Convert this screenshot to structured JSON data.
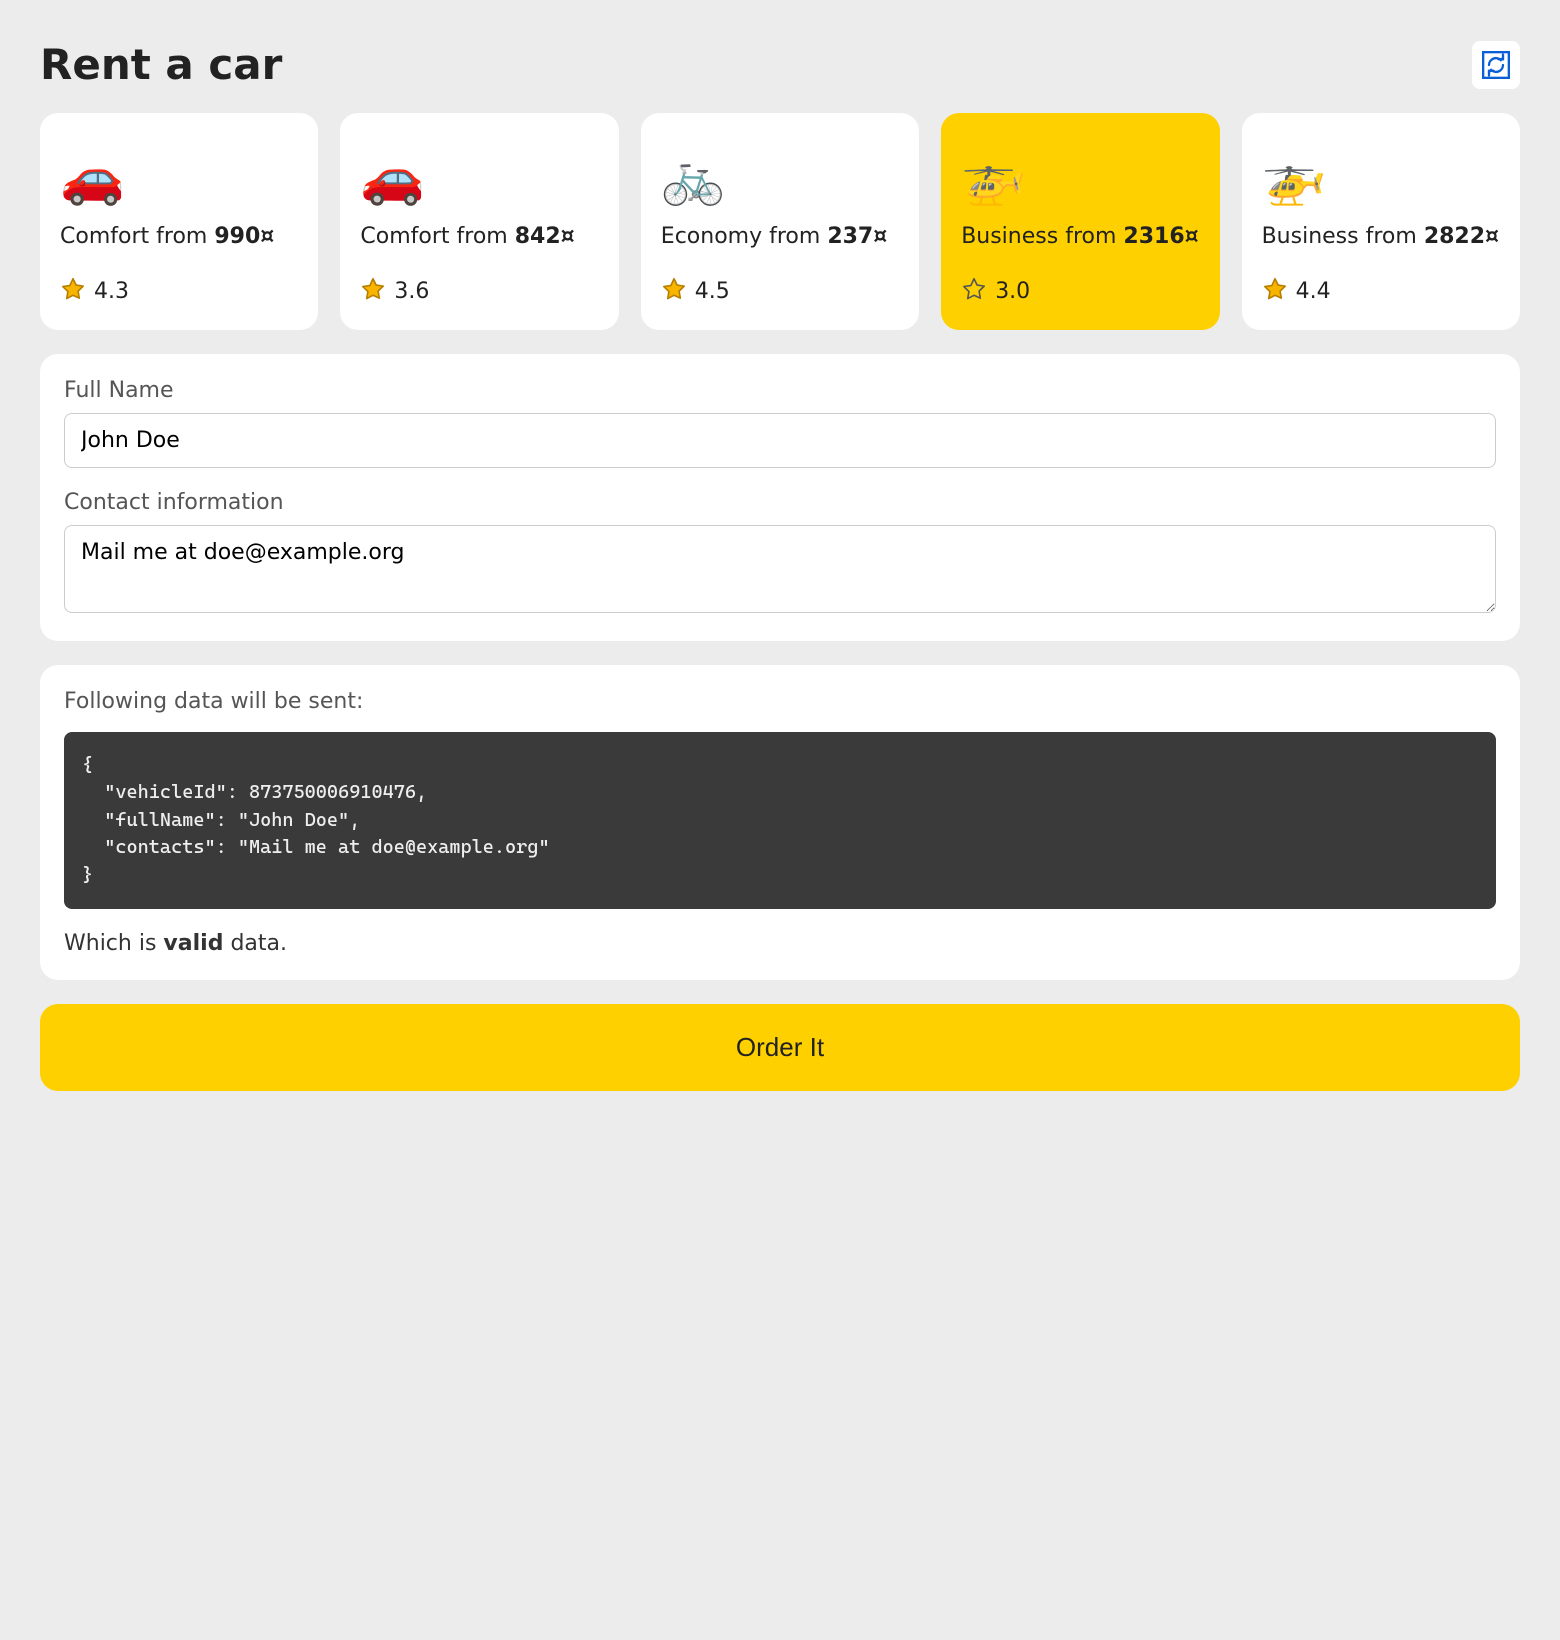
{
  "header": {
    "title": "Rent a car"
  },
  "cards": [
    {
      "icon": "🚗",
      "tier": "Comfort",
      "from": "from",
      "price": "990¤",
      "rating": "4.3",
      "selected": false,
      "star": "filled"
    },
    {
      "icon": "🚗",
      "tier": "Comfort",
      "from": "from",
      "price": "842¤",
      "rating": "3.6",
      "selected": false,
      "star": "filled"
    },
    {
      "icon": "🚲",
      "tier": "Economy",
      "from": "from",
      "price": "237¤",
      "rating": "4.5",
      "selected": false,
      "star": "filled"
    },
    {
      "icon": "🚁",
      "tier": "Business",
      "from": "from",
      "price": "2316¤",
      "rating": "3.0",
      "selected": true,
      "star": "outline"
    },
    {
      "icon": "🚁",
      "tier": "Business",
      "from": "from",
      "price": "2822¤",
      "rating": "4.4",
      "selected": false,
      "star": "filled"
    }
  ],
  "form": {
    "full_name_label": "Full Name",
    "full_name_value": "John Doe",
    "contact_label": "Contact information",
    "contact_value": "Mail me at doe@example.org"
  },
  "summary": {
    "intro": "Following data will be sent:",
    "json_text": "{\n  \"vehicleId\": 873750006910476,\n  \"fullName\": \"John Doe\",\n  \"contacts\": \"Mail me at doe@example.org\"\n}",
    "validity_prefix": "Which is ",
    "validity_word": "valid",
    "validity_suffix": " data."
  },
  "order_button": "Order It"
}
